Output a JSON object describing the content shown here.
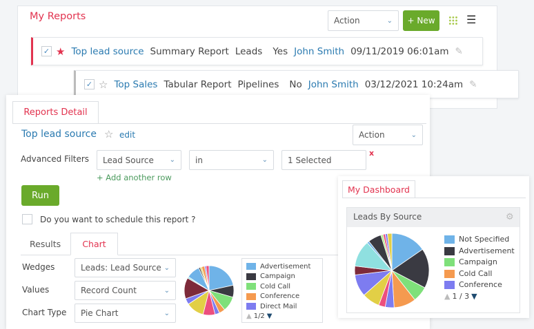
{
  "my_reports": {
    "title": "My Reports",
    "action": "Action",
    "new_label": "+ New",
    "rows": [
      {
        "name": "Top lead source",
        "type": "Summary Report",
        "module": "Leads",
        "shared": "Yes",
        "owner": "John Smith",
        "date": "09/11/2019 06:01am",
        "starred": true,
        "checked": true
      },
      {
        "name": "Top Sales",
        "type": "Tabular Report",
        "module": "Pipelines",
        "shared": "No",
        "owner": "John Smith",
        "date": "03/12/2021 10:24am",
        "starred": false,
        "checked": true
      }
    ]
  },
  "detail": {
    "tab": "Reports Detail",
    "report_name": "Top lead source",
    "edit": "edit",
    "action": "Action",
    "filters_label": "Advanced Filters",
    "filter_field": "Lead Source",
    "filter_op": "in",
    "filter_value": "1 Selected",
    "remove": "x",
    "add_row": "+ Add another row",
    "run": "Run",
    "schedule": "Do you want to schedule this report ?",
    "tabs": [
      "Results",
      "Chart"
    ],
    "active_tab": "Chart",
    "wedges_label": "Wedges",
    "wedges_value": "Leads: Lead Source",
    "values_label": "Values",
    "values_value": "Record Count",
    "chart_type_label": "Chart Type",
    "chart_type_value": "Pie Chart",
    "legend": [
      {
        "label": "Advertisement",
        "color": "#6fb3e8"
      },
      {
        "label": "Campaign",
        "color": "#3a3a42"
      },
      {
        "label": "Cold Call",
        "color": "#7fe07a"
      },
      {
        "label": "Conference",
        "color": "#f59a4f"
      },
      {
        "label": "Direct Mail",
        "color": "#7d7cf0"
      }
    ],
    "pager": "1/2"
  },
  "dashboard": {
    "tab": "My Dashboard",
    "widget_title": "Leads By Source",
    "legend": [
      {
        "label": "Not Specified",
        "color": "#6fb3e8"
      },
      {
        "label": "Advertisement",
        "color": "#3a3a42"
      },
      {
        "label": "Campaign",
        "color": "#7fe07a"
      },
      {
        "label": "Cold Call",
        "color": "#f59a4f"
      },
      {
        "label": "Conference",
        "color": "#7d7cf0"
      }
    ],
    "pager": "1 / 3"
  },
  "chart_data": [
    {
      "type": "pie",
      "slices": [
        {
          "value": 22,
          "color": "#6fb3e8"
        },
        {
          "value": 8,
          "color": "#3a3a42"
        },
        {
          "value": 10,
          "color": "#7fe07a"
        },
        {
          "value": 4,
          "color": "#f59a4f"
        },
        {
          "value": 3,
          "color": "#7d7cf0"
        },
        {
          "value": 8,
          "color": "#ec4f7e"
        },
        {
          "value": 12,
          "color": "#e2cf46"
        },
        {
          "value": 4,
          "color": "#7d7cf0"
        },
        {
          "value": 14,
          "color": "#7d2a3a"
        },
        {
          "value": 1,
          "color": "#8fe0e0"
        },
        {
          "value": 9,
          "color": "#6fb3e8"
        },
        {
          "value": 1,
          "color": "#3a3a42"
        },
        {
          "value": 1,
          "color": "#e2cf46"
        },
        {
          "value": 2,
          "color": "#f59a4f"
        },
        {
          "value": 1,
          "color": "#7d7cf0"
        },
        {
          "value": 2,
          "color": "#ec4f7e"
        }
      ]
    },
    {
      "type": "pie",
      "slices": [
        {
          "value": 16,
          "color": "#6fb3e8"
        },
        {
          "value": 18,
          "color": "#3a3a42"
        },
        {
          "value": 7,
          "color": "#7fe07a"
        },
        {
          "value": 10,
          "color": "#f59a4f"
        },
        {
          "value": 4,
          "color": "#7d7cf0"
        },
        {
          "value": 3,
          "color": "#ec4f7e"
        },
        {
          "value": 8,
          "color": "#e2cf46"
        },
        {
          "value": 10,
          "color": "#7d7cf0"
        },
        {
          "value": 4,
          "color": "#7d2a3a"
        },
        {
          "value": 12,
          "color": "#8fe0e0"
        },
        {
          "value": 1,
          "color": "#6fb3e8"
        },
        {
          "value": 6,
          "color": "#3a3a42"
        },
        {
          "value": 1,
          "color": "#b4e88a"
        },
        {
          "value": 1,
          "color": "#ec4f7e"
        },
        {
          "value": 1,
          "color": "#7d7cf0"
        },
        {
          "value": 2,
          "color": "#e2cf46"
        }
      ]
    }
  ]
}
